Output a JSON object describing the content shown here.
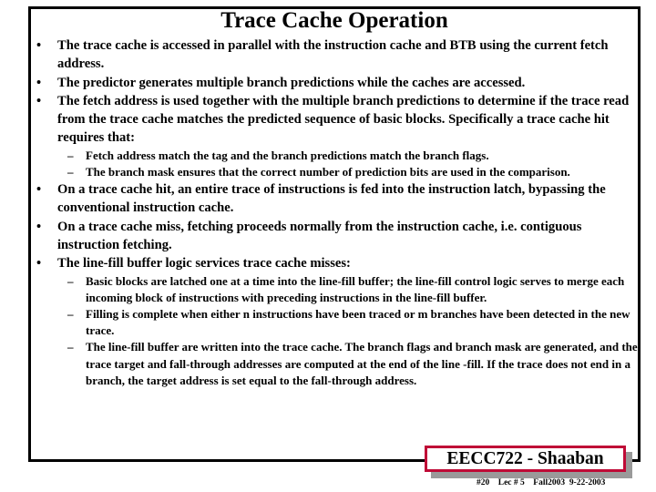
{
  "slide": {
    "title": "Trace Cache Operation",
    "bullets": [
      {
        "text": "The trace cache is accessed in parallel with the instruction cache and BTB using the current fetch address.",
        "marker": "•",
        "subs": []
      },
      {
        "text": "The predictor generates multiple branch predictions while the caches are accessed.",
        "marker": "•",
        "subs": []
      },
      {
        "text": "The fetch address is used together with the multiple branch predictions to determine if the trace read from the trace cache matches the predicted sequence of basic blocks. Specifically a trace cache hit requires that:",
        "marker": "•",
        "subs": [
          {
            "marker": "–",
            "text": "Fetch address match the tag and  the branch predictions match the branch flags."
          },
          {
            "marker": "–",
            "text": "The branch mask ensures that the correct number of prediction bits are used in the comparison."
          }
        ]
      },
      {
        "text": "On a trace cache hit, an entire trace of instructions is fed into the instruction latch, bypassing the conventional instruction cache.",
        "marker": "•",
        "subs": []
      },
      {
        "text": "On a trace cache miss, fetching proceeds normally from the instruction cache, i.e. contiguous instruction fetching.",
        "marker": "•",
        "subs": []
      },
      {
        "text": "The line-fill buffer logic services trace cache misses:",
        "marker": "•",
        "subs": [
          {
            "marker": "–",
            "text": "Basic blocks are latched one at a time into the line-fill buffer; the line-fill control logic serves to merge each incoming block of instructions with preceding instructions in the line-fill buffer."
          },
          {
            "marker": "–",
            "text": "Filling is complete when either n instructions have been traced or m branches have been detected in the new trace."
          },
          {
            "marker": "–",
            "text": "The line-fill buffer are written into the trace cache. The branch flags and branch mask are generated, and the trace target and fall-through addresses are computed at the end of the line -fill. If the trace does not end in a branch, the target address is set equal to the fall-through address."
          }
        ]
      }
    ]
  },
  "footer": {
    "course_instructor": "EECC722 - Shaaban",
    "meta": "#20    Lec # 5    Fall2003  9-22-2003",
    "border_color": "#bf0a36",
    "shadow_color": "#9a9a9a"
  }
}
